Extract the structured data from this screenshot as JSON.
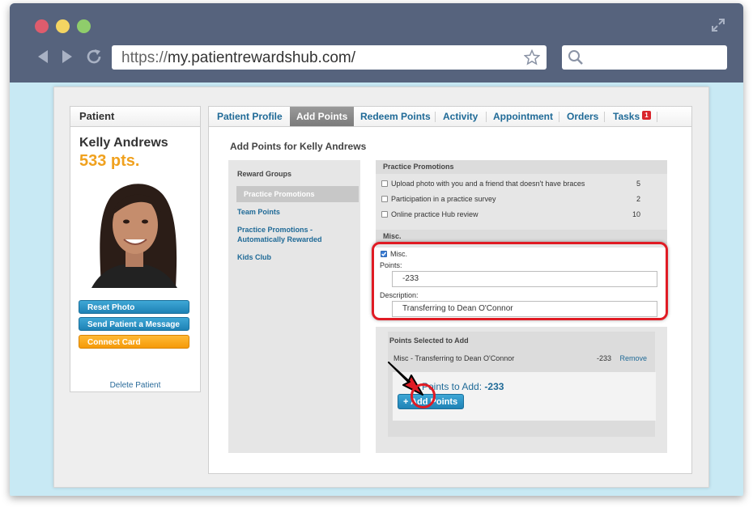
{
  "browser": {
    "url_scheme": "https://",
    "url_host": "my.patientrewardshub.com/",
    "colors": {
      "chrome": "#56637d",
      "page_bg": "#c8e9f4"
    }
  },
  "patient_panel": {
    "title": "Patient",
    "name": "Kelly Andrews",
    "points": "533 pts.",
    "buttons": {
      "reset_photo": "Reset Photo",
      "send_message": "Send Patient a Message",
      "connect_card": "Connect Card"
    },
    "delete_link": "Delete Patient"
  },
  "tabs": {
    "profile": "Patient Profile",
    "add_points": "Add Points",
    "redeem": "Redeem Points",
    "activity": "Activity",
    "appointment": "Appointment",
    "orders": "Orders",
    "tasks": "Tasks",
    "tasks_badge": "1"
  },
  "add_points": {
    "title": "Add Points for Kelly Andrews",
    "reward_groups_head": "Reward Groups",
    "groups": {
      "practice_promotions": "Practice Promotions",
      "team_points": "Team Points",
      "auto_line1": "Practice Promotions -",
      "auto_line2": "Automatically Rewarded",
      "kids_club": "Kids Club"
    },
    "promotions_head": "Practice Promotions",
    "promotions": [
      {
        "label": "Upload photo with you and a friend that doesn't have braces",
        "points": "5"
      },
      {
        "label": "Participation in a practice survey",
        "points": "2"
      },
      {
        "label": "Online practice Hub review",
        "points": "10"
      }
    ],
    "misc_head": "Misc.",
    "misc_checkbox": "Misc.",
    "points_label": "Points:",
    "points_value": "-233",
    "description_label": "Description:",
    "description_value": "Transferring to Dean O'Connor",
    "selected_head": "Points Selected to Add",
    "selected_item": "Misc - Transferring to Dean O'Connor",
    "selected_amount": "-233",
    "remove_link": "Remove",
    "total_label": "Points to Add:",
    "total_value": "-233",
    "add_button": "+ Add Points"
  }
}
